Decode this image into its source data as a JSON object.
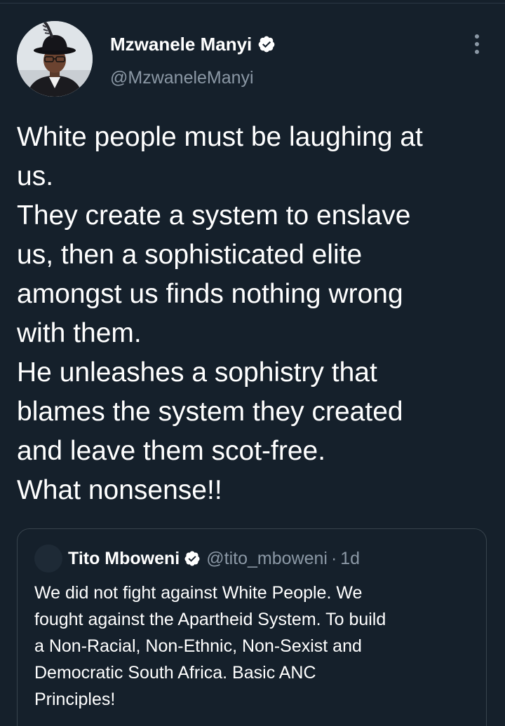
{
  "tweet": {
    "author": {
      "display_name": "Mzwanele Manyi",
      "handle": "@MzwaneleManyi",
      "verified": true,
      "avatar_icon": "profile-photo"
    },
    "text_lines": [
      "White people must be laughing at",
      "us.",
      "They create a system to enslave",
      "us, then a sophisticated elite",
      "amongst us finds nothing wrong",
      "with them.",
      "He unleashes a sophistry that",
      "blames the system they created",
      "and leave them scot-free.",
      "What nonsense!!"
    ],
    "more_icon": "more-vertical-icon"
  },
  "quoted_tweet": {
    "display_name": "Tito Mboweni",
    "handle": "@tito_mboweni",
    "separator": "·",
    "time": "1d",
    "verified": true,
    "text_lines": [
      "We did not fight against White People. We",
      "fought against the Apartheid System. To build",
      "a Non-Racial, Non-Ethnic, Non-Sexist and",
      "Democratic South Africa. Basic ANC",
      "Principles!"
    ]
  },
  "colors": {
    "background": "#15202b",
    "primary_text": "#ffffff",
    "secondary_text": "#8b98a5",
    "border": "#38444d",
    "verified_badge": "#ffffff"
  }
}
